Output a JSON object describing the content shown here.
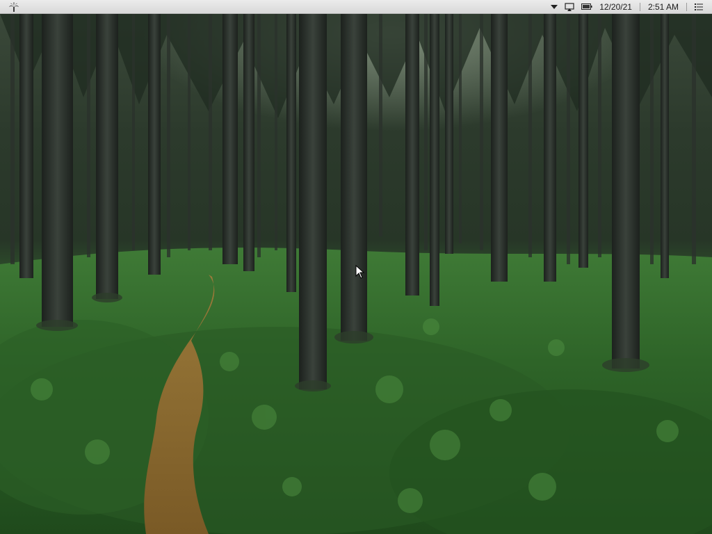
{
  "desktop": {
    "wallpaper": "forest-path-wallpaper"
  },
  "menubar": {
    "logo_icon": "palm-tree-icon",
    "status_icons": [
      "dropdown-triangle-icon",
      "airplay-icon",
      "battery-icon",
      "list-menu-icon"
    ],
    "date": "12/20/21",
    "time": "2:51 AM"
  },
  "colors": {
    "menubar_bg": "#e3e3e3",
    "foliage": "#2f6a2a",
    "trunk": "#2a302b",
    "path": "#8a6a2e"
  }
}
